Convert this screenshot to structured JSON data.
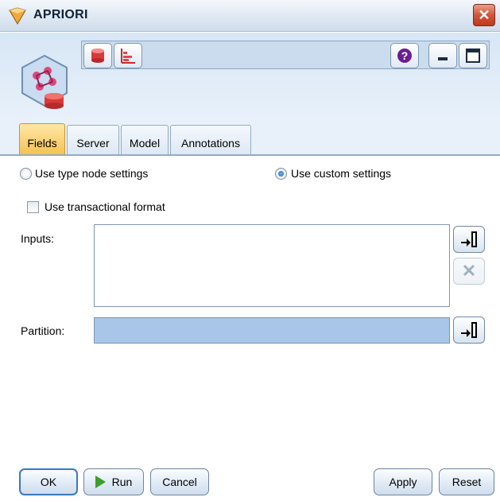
{
  "window": {
    "title": "APRIORI",
    "close_glyph": "✕"
  },
  "toolbar": {
    "buttons": [
      {
        "icon": "database-preview-icon"
      },
      {
        "icon": "bar-chart-icon"
      }
    ],
    "right_buttons": [
      {
        "icon": "help-icon",
        "glyph": "?"
      },
      {
        "icon": "minimize-icon"
      },
      {
        "icon": "maximize-icon"
      }
    ]
  },
  "tabs": [
    {
      "label": "Fields",
      "active": true
    },
    {
      "label": "Server"
    },
    {
      "label": "Model"
    },
    {
      "label": "Annotations"
    }
  ],
  "fields": {
    "option_type_node": "Use type node settings",
    "option_custom": "Use custom settings",
    "selected_option": "custom",
    "transactional_label": "Use transactional format",
    "transactional_checked": false,
    "inputs_label": "Inputs:",
    "partition_label": "Partition:",
    "remove_glyph": "✕"
  },
  "buttons": {
    "ok": "OK",
    "run": "Run",
    "cancel": "Cancel",
    "apply": "Apply",
    "reset": "Reset"
  },
  "colors": {
    "active_tab": "#f5c150",
    "partition_fill": "#a9c6e8",
    "close_button": "#c0381d"
  }
}
